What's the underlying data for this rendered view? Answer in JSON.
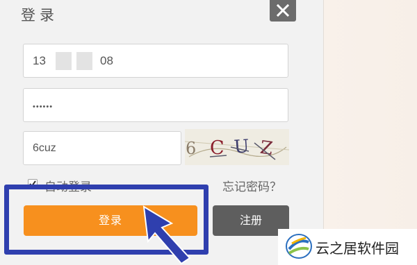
{
  "dialog": {
    "title": "登录",
    "close_icon": "close-icon"
  },
  "form": {
    "phone_prefix": "13",
    "phone_suffix": "08",
    "password_mask": "••••••",
    "captcha_input": "6cuz",
    "captcha_image_text": "6CUZ",
    "remember_label": "自动登录",
    "remember_checked": true,
    "forgot_link": "忘记密码？"
  },
  "buttons": {
    "login": "登录",
    "register": "注册"
  },
  "annotation": {
    "highlight_color": "#2f3fae",
    "arrow_color": "#2f3fae"
  },
  "watermark": {
    "text": "云之居软件园"
  },
  "colors": {
    "login_button": "#f7901e",
    "register_button": "#5e5e5e",
    "close_button": "#6c6c6c"
  }
}
